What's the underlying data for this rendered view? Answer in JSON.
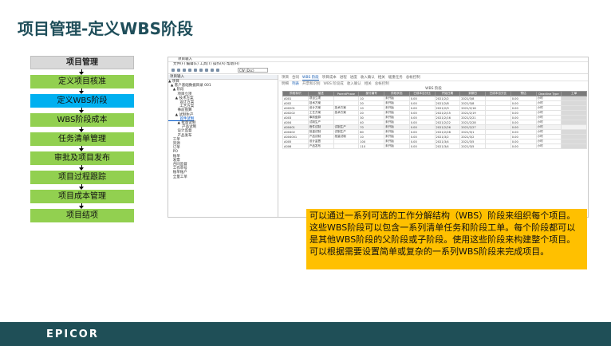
{
  "slide": {
    "title": "项目管理-定义WBS阶段",
    "note": "可以通过一系列可选的工作分解结构（WBS）阶段来组织每个项目。这些WBS阶段可以包含一系列清单任务和阶段工单。每个阶段都可以是其他WBS阶段的父阶段或子阶段。使用这些阶段来构建整个项目。可以根据需要设置简单或复杂的一系列WBS阶段来完成项目。"
  },
  "flow": {
    "header": "项目管理",
    "steps": [
      "定义项目核准",
      "定义WBS阶段",
      "WBS阶段成本",
      "任务清单管理",
      "审批及项目发布",
      "项目过程跟踪",
      "项目成本管理",
      "项目结项"
    ],
    "active_index": 1,
    "active_color": "#00b0f0",
    "step_color": "#92d050"
  },
  "screenshot": {
    "title": "项目输入",
    "menu": "文件(F)  编辑(E)  工具(T)  操作(A)  帮助(H)",
    "company_combo": "CW (Dsc)",
    "left_header": "项目输入",
    "tree": [
      "▲ 项目",
      "  ▲ 客户基础数据目录 001",
      "    ▲ 阶段",
      "        项目立项",
      "      ▲ 技术方案",
      "          设计方案",
      "          工艺方案",
      "        事前盘算",
      "      ▲ 试制生产",
      "          首件试制",
      "        ▲ 批量试制",
      "            产品试制",
      "        设计监督",
      "        产品发布",
      "    工单",
      "    资源",
      "    订单",
      "    PO",
      "    账单",
      "    发票",
      "    合同监督",
      "    工作单号",
      "    账单账户",
      "    全量工单"
    ],
    "tree_selected_index": 9,
    "tabs": [
      "项目",
      "合同",
      "WBS 阶段",
      "项目成本",
      "进程",
      "进度",
      "收入确认",
      "相关",
      "缓重任务",
      "总帐控制"
    ],
    "active_tab": 2,
    "subtabs": [
      "明细",
      "列表",
      "开票和识别",
      "WBS 阶段成",
      "收入确认",
      "相关",
      "总帐控制"
    ],
    "active_subtab": 1,
    "grid_caption": "WBS 阶段",
    "columns": [
      "阶段标识",
      "描述",
      "ParentPhase",
      "部分编号",
      "阶段状态",
      "已成本百分比",
      "开始日期",
      "到期日",
      "已成本百分比",
      "预估",
      "Deadline Type",
      "工单"
    ],
    "rows": [
      [
        "A001",
        "项目立项",
        "",
        "10",
        "未开始",
        "0.00",
        "2021/2/2",
        "2021/3/8",
        "",
        "0.00",
        "小时"
      ],
      [
        "A002",
        "技术方案",
        "",
        "20",
        "未开始",
        "0.00",
        "2021/2/8",
        "2021/3/8",
        "",
        "0.00",
        "小时"
      ],
      [
        "A00201",
        "设计方案",
        "技术方案",
        "10",
        "未开始",
        "0.00",
        "2021/2/9",
        "2021/2/16",
        "",
        "0.00",
        "小时"
      ],
      [
        "A00202",
        "工艺方案",
        "技术方案",
        "20",
        "未开始",
        "0.00",
        "2021/2/15",
        "2021/2/19",
        "",
        "0.00",
        "小时"
      ],
      [
        "A003",
        "事前盘算",
        "",
        "30",
        "未开始",
        "0.00",
        "2021/2/16",
        "2021/2/21",
        "",
        "0.00",
        "小时"
      ],
      [
        "A004",
        "试制生产",
        "",
        "40",
        "未开始",
        "0.00",
        "2021/2/22",
        "2021/2/28",
        "",
        "0.00",
        "小时"
      ],
      [
        "A00401",
        "首件试制",
        "试制生产",
        "70",
        "未开始",
        "0.00",
        "2021/2/26",
        "2021/2/27",
        "",
        "0.00",
        "小时"
      ],
      [
        "A00402",
        "批量试制",
        "试制生产",
        "80",
        "未开始",
        "0.00",
        "2021/2/28",
        "2021/3/1",
        "",
        "0.00",
        "小时"
      ],
      [
        "A004001",
        "产品试制",
        "批量试制",
        "10",
        "未开始",
        "0.00",
        "2021/3/2",
        "2021/3/2",
        "",
        "0.00",
        "小时"
      ],
      [
        "A005",
        "设计监督",
        "",
        "100",
        "未开始",
        "0.00",
        "2021/3/4",
        "2021/3/5",
        "",
        "0.00",
        "小时"
      ],
      [
        "A006",
        "产品发布",
        "",
        "110",
        "未开始",
        "0.00",
        "2021/3/4",
        "2021/3/5",
        "",
        "0.00",
        "小时"
      ]
    ],
    "marked_row_index": 6
  },
  "footer": {
    "logo": "EPICOR",
    "background": "#1f4f57"
  }
}
